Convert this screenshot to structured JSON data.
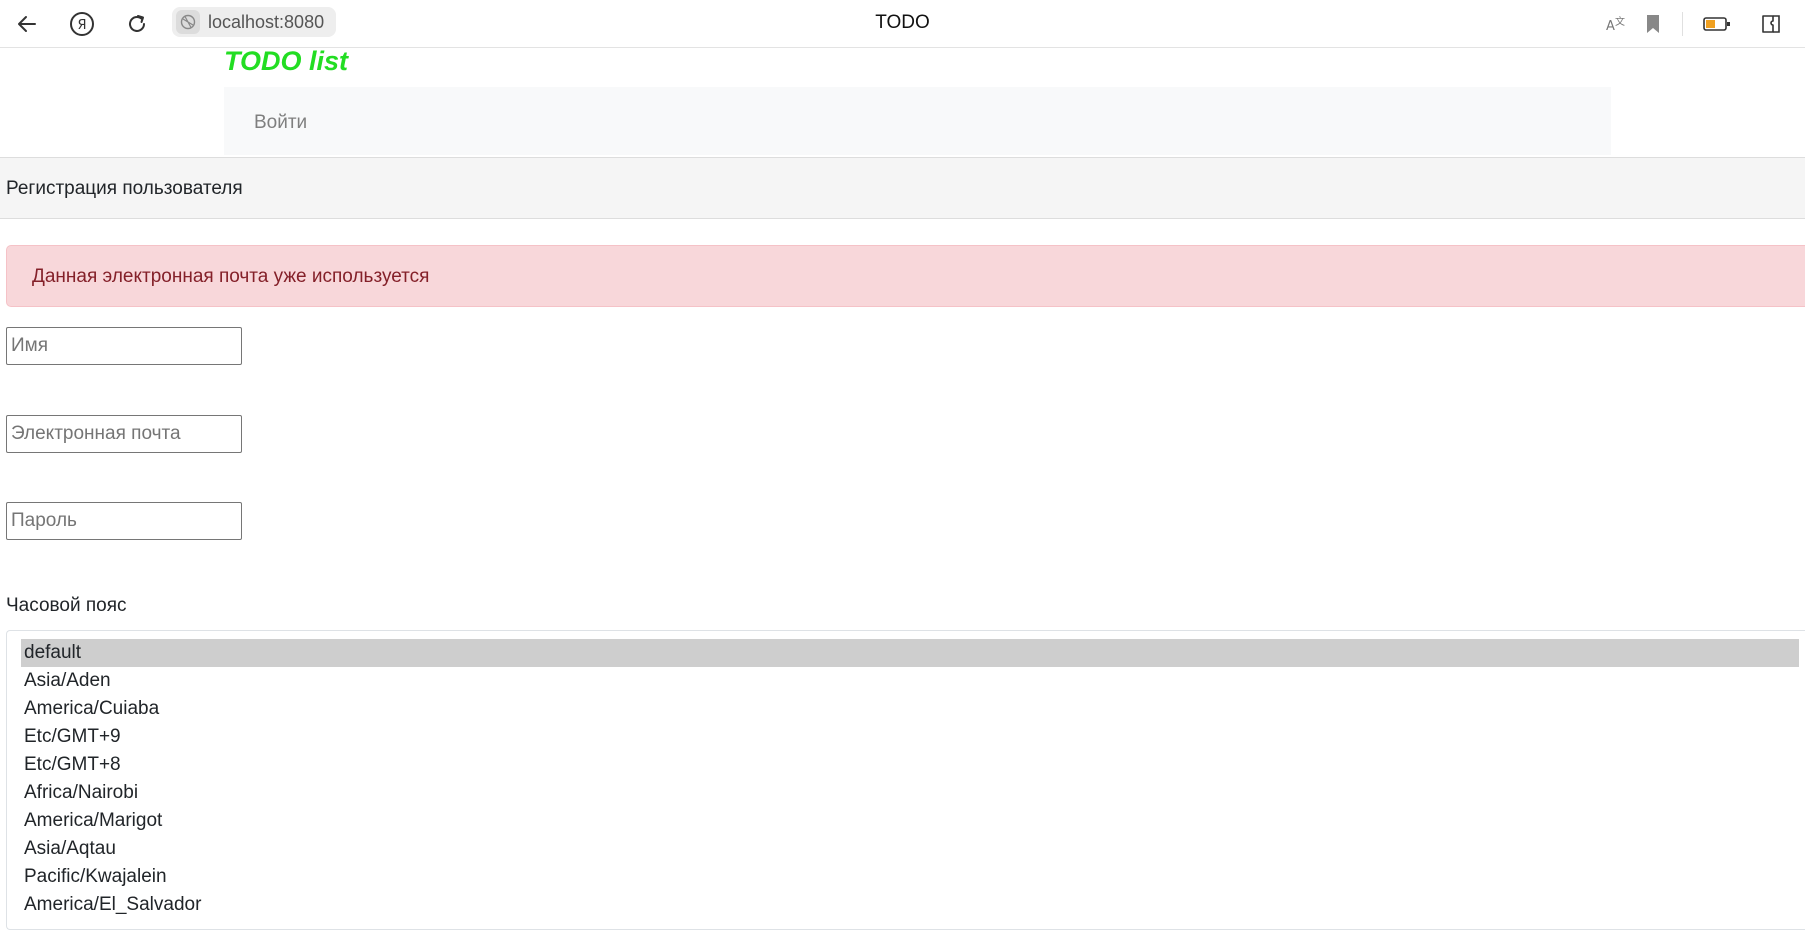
{
  "browser": {
    "address": "localhost:8080",
    "tab_title": "TODO",
    "translate_icon_label": "A文"
  },
  "page": {
    "brand": "TODO list",
    "nav": {
      "login_label": "Войти"
    },
    "section_title": "Регистрация пользователя",
    "alert_message": "Данная электронная почта уже используется",
    "form": {
      "name_placeholder": "Имя",
      "email_placeholder": "Электронная почта",
      "password_placeholder": "Пароль"
    },
    "timezone": {
      "label": "Часовой пояс",
      "selected": "default",
      "options": [
        "default",
        "Asia/Aden",
        "America/Cuiaba",
        "Etc/GMT+9",
        "Etc/GMT+8",
        "Africa/Nairobi",
        "America/Marigot",
        "Asia/Aqtau",
        "Pacific/Kwajalein",
        "America/El_Salvador"
      ]
    }
  },
  "colors": {
    "brand": "#22dd22",
    "alert_bg": "#f8d7da",
    "alert_text": "#842029",
    "selected_option_bg": "#cecece"
  }
}
